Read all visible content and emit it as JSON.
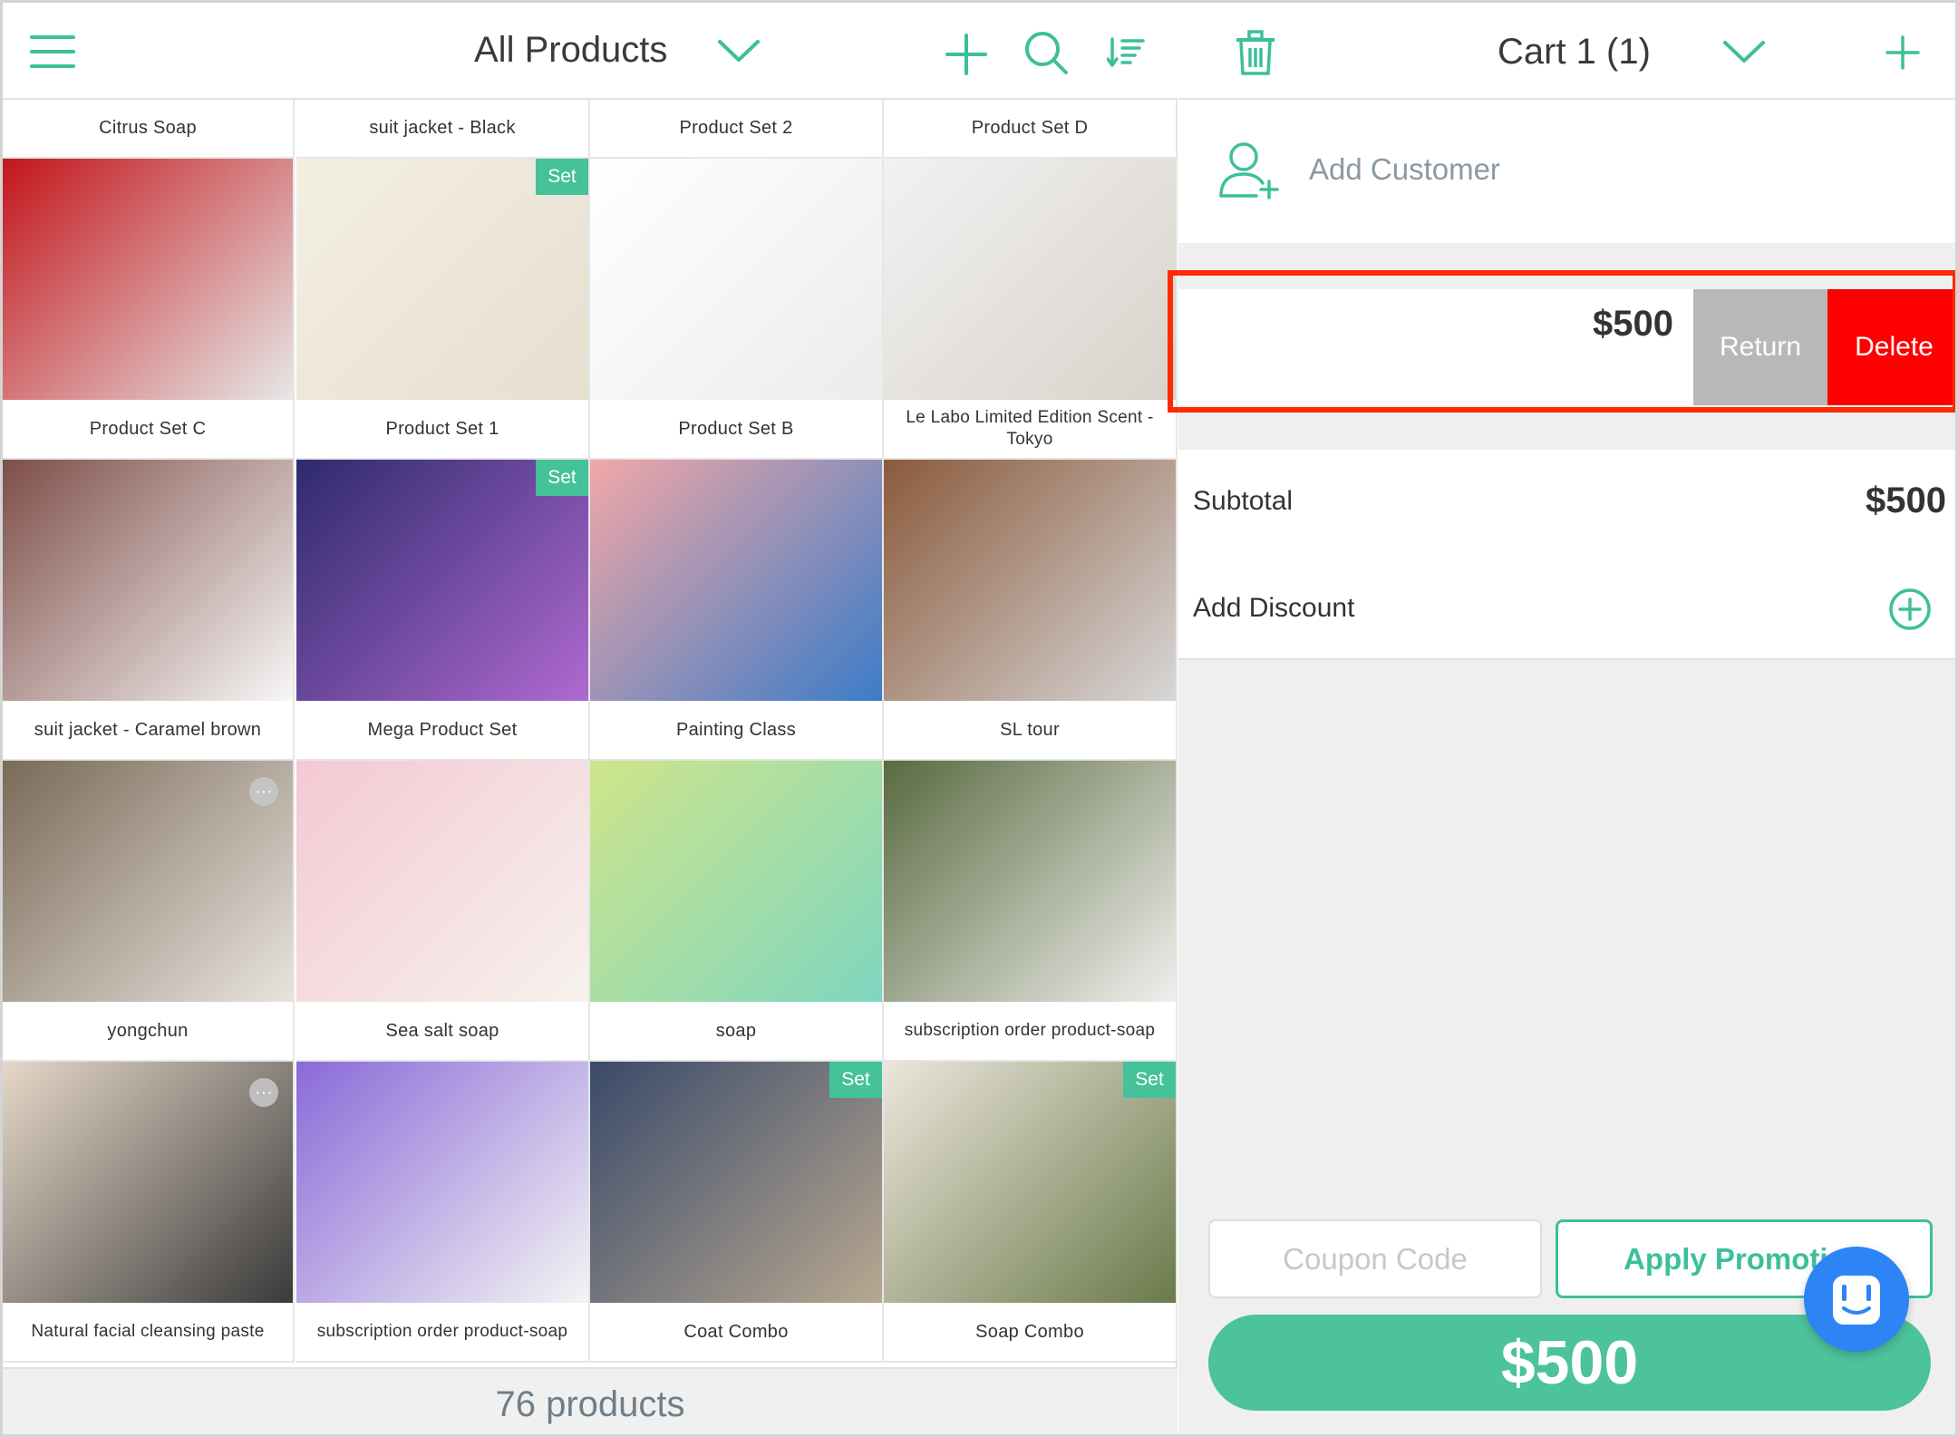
{
  "left_header": {
    "title": "All Products",
    "icons": [
      "menu-icon",
      "chevron-down-icon",
      "plus-icon",
      "search-icon",
      "sort-icon"
    ]
  },
  "products": [
    {
      "name": "Citrus Soap",
      "set": false,
      "more": false,
      "colors": [
        "#e8e0b0",
        "#f4f0d8"
      ]
    },
    {
      "name": "suit jacket - Black",
      "set": false,
      "more": false,
      "colors": [
        "#2a2a2a",
        "#ececec"
      ]
    },
    {
      "name": "Product Set 2",
      "set": false,
      "more": false,
      "colors": [
        "#d8c0b8",
        "#f0e6e2"
      ]
    },
    {
      "name": "Product Set D",
      "set": false,
      "more": false,
      "colors": [
        "#b05050",
        "#f0e0e0"
      ]
    },
    {
      "name": "Product Set C",
      "set": false,
      "more": false,
      "colors": [
        "#c3161c",
        "#e8e8e8"
      ]
    },
    {
      "name": "Product Set 1",
      "set": true,
      "more": false,
      "colors": [
        "#f3efe3",
        "#e7dfd0"
      ]
    },
    {
      "name": "Product Set B",
      "set": false,
      "more": false,
      "colors": [
        "#ffffff",
        "#ececec"
      ]
    },
    {
      "name": "Le Labo Limited Edition Scent - Tokyo",
      "set": false,
      "more": false,
      "colors": [
        "#f2f2f2",
        "#d8d2ca"
      ]
    },
    {
      "name": "suit jacket - Caramel brown",
      "set": false,
      "more": false,
      "colors": [
        "#7e4e48",
        "#f8f8f8"
      ]
    },
    {
      "name": "Mega Product Set",
      "set": true,
      "more": false,
      "colors": [
        "#2e2a6e",
        "#b06ad0"
      ]
    },
    {
      "name": "Painting Class",
      "set": false,
      "more": false,
      "colors": [
        "#f2a7a7",
        "#3a7cc8"
      ]
    },
    {
      "name": "SL tour",
      "set": false,
      "more": false,
      "colors": [
        "#8b5a3c",
        "#d8d8d8"
      ]
    },
    {
      "name": "yongchun",
      "set": false,
      "more": true,
      "colors": [
        "#7a6a58",
        "#e8e4de"
      ]
    },
    {
      "name": "Sea salt soap",
      "set": false,
      "more": false,
      "colors": [
        "#f4c8d4",
        "#f6f2ec"
      ]
    },
    {
      "name": "soap",
      "set": false,
      "more": false,
      "colors": [
        "#cfe58a",
        "#7ed6c0"
      ]
    },
    {
      "name": "subscription order product-soap",
      "set": false,
      "more": false,
      "colors": [
        "#5a6a40",
        "#f0f0ee"
      ]
    },
    {
      "name": "Natural facial cleansing paste",
      "set": false,
      "more": true,
      "colors": [
        "#e6d8c8",
        "#3a3a3a"
      ]
    },
    {
      "name": "subscription order product-soap",
      "set": false,
      "more": false,
      "colors": [
        "#8a6ad8",
        "#f4f4f4"
      ]
    },
    {
      "name": "Coat Combo",
      "set": true,
      "more": false,
      "colors": [
        "#3a4a6a",
        "#b8a890"
      ]
    },
    {
      "name": "Soap Combo",
      "set": true,
      "more": false,
      "colors": [
        "#ece6dc",
        "#6a7a4a"
      ]
    }
  ],
  "set_badge_label": "Set",
  "more_label": "···",
  "footer": {
    "count_text": "76 products"
  },
  "cart": {
    "title": "Cart 1 (1)",
    "add_customer": "Add Customer",
    "item": {
      "price": "$500",
      "return_label": "Return",
      "delete_label": "Delete"
    },
    "subtotal_label": "Subtotal",
    "subtotal_value": "$500",
    "add_discount_label": "Add Discount",
    "coupon_placeholder": "Coupon Code",
    "apply_label": "Apply Promotion",
    "pay_total": "$500"
  },
  "colors": {
    "accent": "#3dbf9a",
    "delete": "#ff0000",
    "return": "#b8b8b8",
    "highlight": "#ff2a00",
    "chat": "#2c84f5"
  }
}
